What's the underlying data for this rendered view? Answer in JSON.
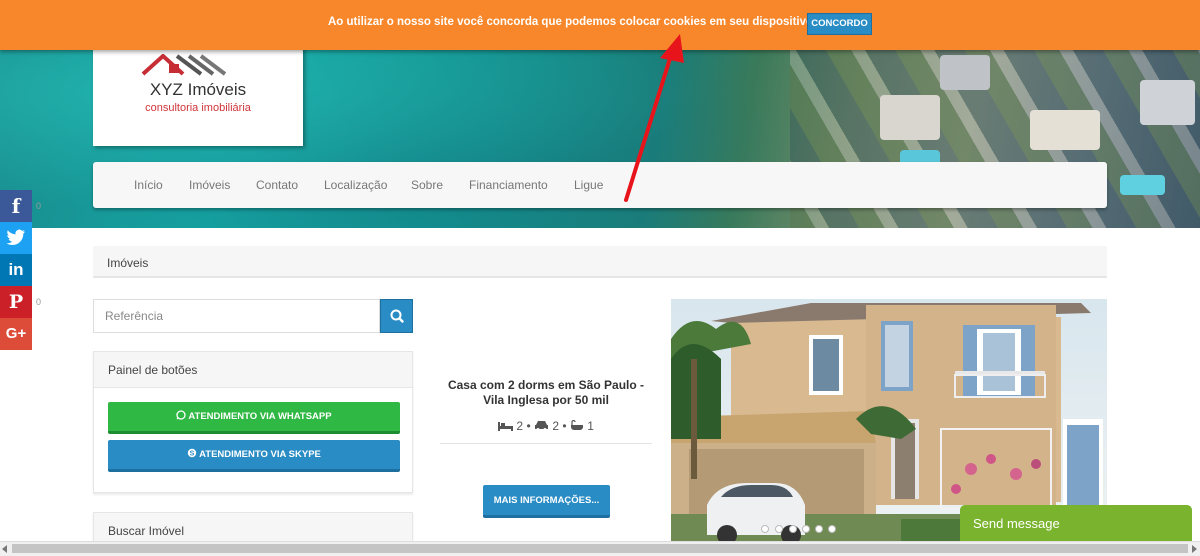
{
  "cookie_bar": {
    "message": "Ao utilizar o nosso site você concorda que podemos colocar cookies em seu dispositivo.",
    "accept_label": "CONCORDO"
  },
  "logo": {
    "title": "XYZ Imóveis",
    "subtitle": "consultoria imobiliária"
  },
  "nav": {
    "items": [
      {
        "label": "Início"
      },
      {
        "label": "Imóveis"
      },
      {
        "label": "Contato"
      },
      {
        "label": "Localização"
      },
      {
        "label": "Sobre"
      },
      {
        "label": "Financiamento"
      },
      {
        "label": "Ligue"
      }
    ]
  },
  "social": {
    "buttons": [
      {
        "name": "facebook",
        "glyph": "f",
        "color": "#3b5998",
        "count": "0"
      },
      {
        "name": "twitter",
        "glyph": "t",
        "color": "#1da1f2"
      },
      {
        "name": "linkedin",
        "glyph": "in",
        "color": "#0077b5"
      },
      {
        "name": "pinterest",
        "glyph": "P",
        "color": "#cb2027",
        "count": "0"
      },
      {
        "name": "google-plus",
        "glyph": "G+",
        "color": "#dd4b39"
      }
    ]
  },
  "breadcrumb": {
    "current": "Imóveis"
  },
  "search": {
    "placeholder": "Referência"
  },
  "panels": {
    "buttons_panel": {
      "title": "Painel de botões",
      "whatsapp_label": "ATENDIMENTO VIA WHATSAPP",
      "skype_label": "ATENDIMENTO VIA SKYPE"
    },
    "search_panel": {
      "title": "Buscar Imóvel"
    }
  },
  "listing": {
    "title": "Casa com 2 dorms em São Paulo - Vila Inglesa por 50 mil",
    "bedrooms": "2",
    "garages": "2",
    "bathrooms": "1",
    "separator": "•",
    "more_label": "MAIS INFORMAÇÕES...",
    "carousel_dots": 7,
    "active_dot": 0
  },
  "chat": {
    "label": "Send message"
  },
  "colors": {
    "cookie_bar": "#f7872a",
    "primary_blue": "#2a8cc4",
    "whatsapp_green": "#2fb843",
    "chat_green": "#7ab32e",
    "logo_red": "#d0343a"
  }
}
